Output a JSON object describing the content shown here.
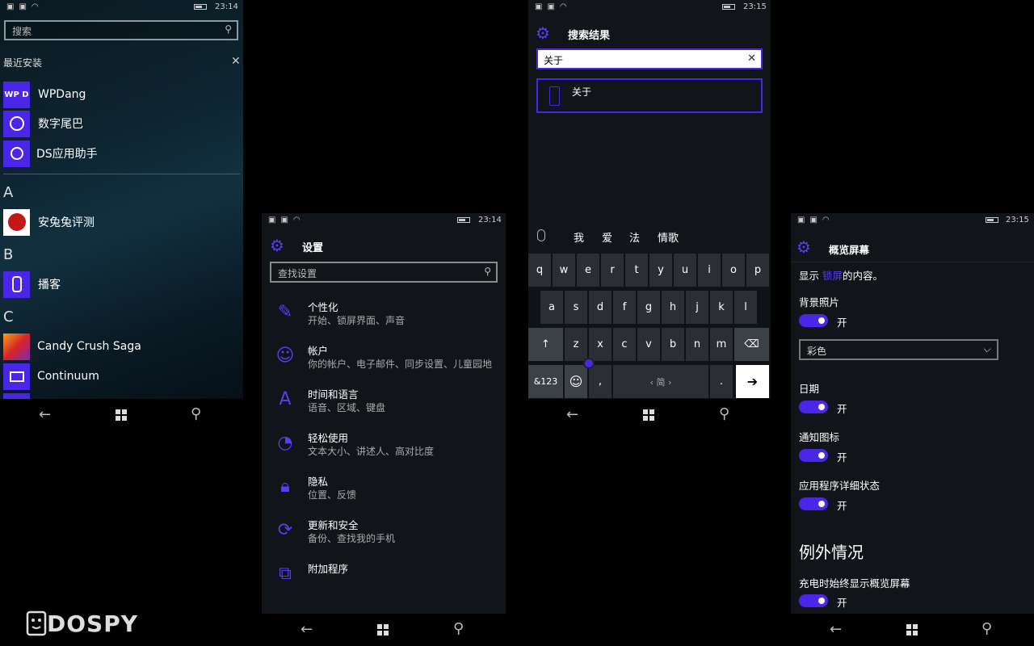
{
  "status": {
    "time1": "23:14",
    "time2": "23:14",
    "time3": "23:15",
    "time4": "23:15"
  },
  "start": {
    "search_placeholder": "搜索",
    "recent_header": "最近安装",
    "recent_apps": [
      {
        "tile": "WP D",
        "name": "WPDang"
      },
      {
        "tile": "",
        "name": "数字尾巴"
      },
      {
        "tile": "",
        "name": "DS应用助手"
      }
    ],
    "letter_a": "A",
    "app_a": "安兔兔评测",
    "letter_b": "B",
    "app_b": "播客",
    "letter_c": "C",
    "app_c1": "Candy Crush Saga",
    "app_c2": "Continuum"
  },
  "settings": {
    "title": "设置",
    "search_placeholder": "查找设置",
    "items": [
      {
        "title": "个性化",
        "sub": "开始、锁屏界面、声音"
      },
      {
        "title": "帐户",
        "sub": "你的帐户、电子邮件、同步设置、儿童园地"
      },
      {
        "title": "时间和语言",
        "sub": "语音、区域、键盘"
      },
      {
        "title": "轻松使用",
        "sub": "文本大小、讲述人、高对比度"
      },
      {
        "title": "隐私",
        "sub": "位置、反馈"
      },
      {
        "title": "更新和安全",
        "sub": "备份、查找我的手机"
      },
      {
        "title": "附加程序",
        "sub": ""
      }
    ]
  },
  "search_results": {
    "title": "搜索结果",
    "query": "关于",
    "result": "关于",
    "suggestions": [
      "我",
      "爱",
      "法",
      "情歌"
    ],
    "keys_row1": [
      "q",
      "w",
      "e",
      "r",
      "t",
      "y",
      "u",
      "i",
      "o",
      "p"
    ],
    "keys_row2": [
      "a",
      "s",
      "d",
      "f",
      "g",
      "h",
      "j",
      "k",
      "l"
    ],
    "keys_row3": [
      "z",
      "x",
      "c",
      "v",
      "b",
      "n",
      "m"
    ],
    "key_123": "&123",
    "key_comma": ",",
    "key_space": "‹ 简 ›",
    "key_period": "."
  },
  "glance": {
    "title": "概览屏幕",
    "intro_a": "显示",
    "intro_link": "锁屏",
    "intro_b": "的内容。",
    "backlight": "背景照片",
    "on": "开",
    "color_select": "彩色",
    "date": "日期",
    "notif": "通知图标",
    "app_status": "应用程序详细状态",
    "section": "例外情况",
    "charging": "充电时始终显示概览屏幕"
  },
  "watermark": "DOSPY"
}
